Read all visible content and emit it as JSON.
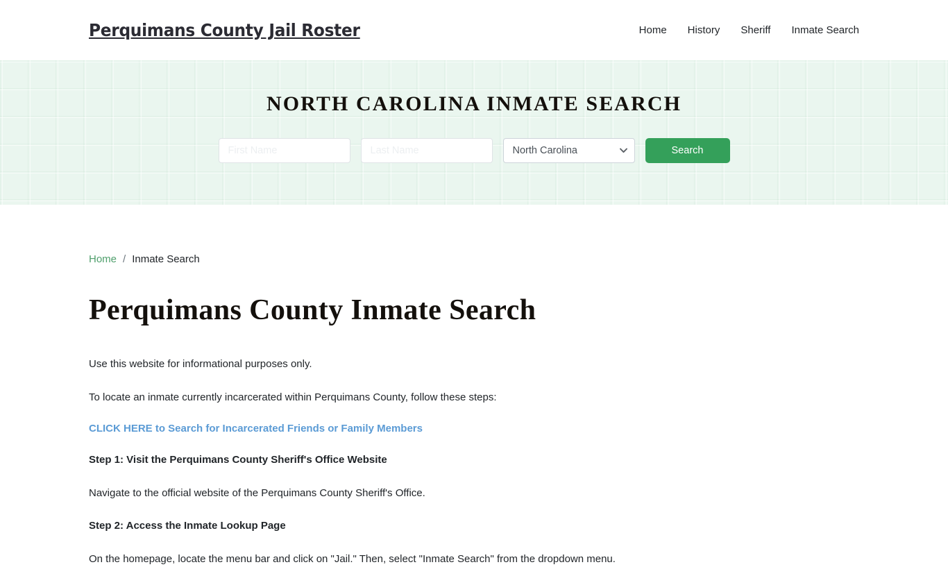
{
  "header": {
    "site_title": "Perquimans County Jail Roster",
    "nav": [
      {
        "label": "Home"
      },
      {
        "label": "History"
      },
      {
        "label": "Sheriff"
      },
      {
        "label": "Inmate Search"
      }
    ]
  },
  "hero": {
    "title": "NORTH CAROLINA INMATE SEARCH",
    "form": {
      "first_name_value": "",
      "first_name_placeholder": "First Name",
      "last_name_value": "",
      "last_name_placeholder": "Last Name",
      "state_selected": "North Carolina",
      "state_options": [
        "North Carolina"
      ],
      "chevron_icon": "chevron-down-icon",
      "search_label": "Search"
    },
    "accent_color": "#34a05a",
    "background_color": "#eaf6ef"
  },
  "breadcrumb": {
    "home_label": "Home",
    "separator": "/",
    "current_label": "Inmate Search",
    "link_color": "#4f9f6c"
  },
  "main": {
    "page_title": "Perquimans County Inmate Search",
    "intro_1": "Use this website for informational purposes only.",
    "intro_2": "To locate an inmate currently incarcerated within Perquimans County, follow these steps:",
    "cta_link": "CLICK HERE to Search for Incarcerated Friends or Family Members",
    "cta_color": "#5b9bd5",
    "steps": [
      {
        "heading": "Step 1: Visit the Perquimans County Sheriff's Office Website",
        "body": "Navigate to the official website of the Perquimans County Sheriff's Office."
      },
      {
        "heading": "Step 2: Access the Inmate Lookup Page",
        "body": "On the homepage, locate the menu bar and click on \"Jail.\" Then, select \"Inmate Search\" from the dropdown menu."
      }
    ]
  }
}
